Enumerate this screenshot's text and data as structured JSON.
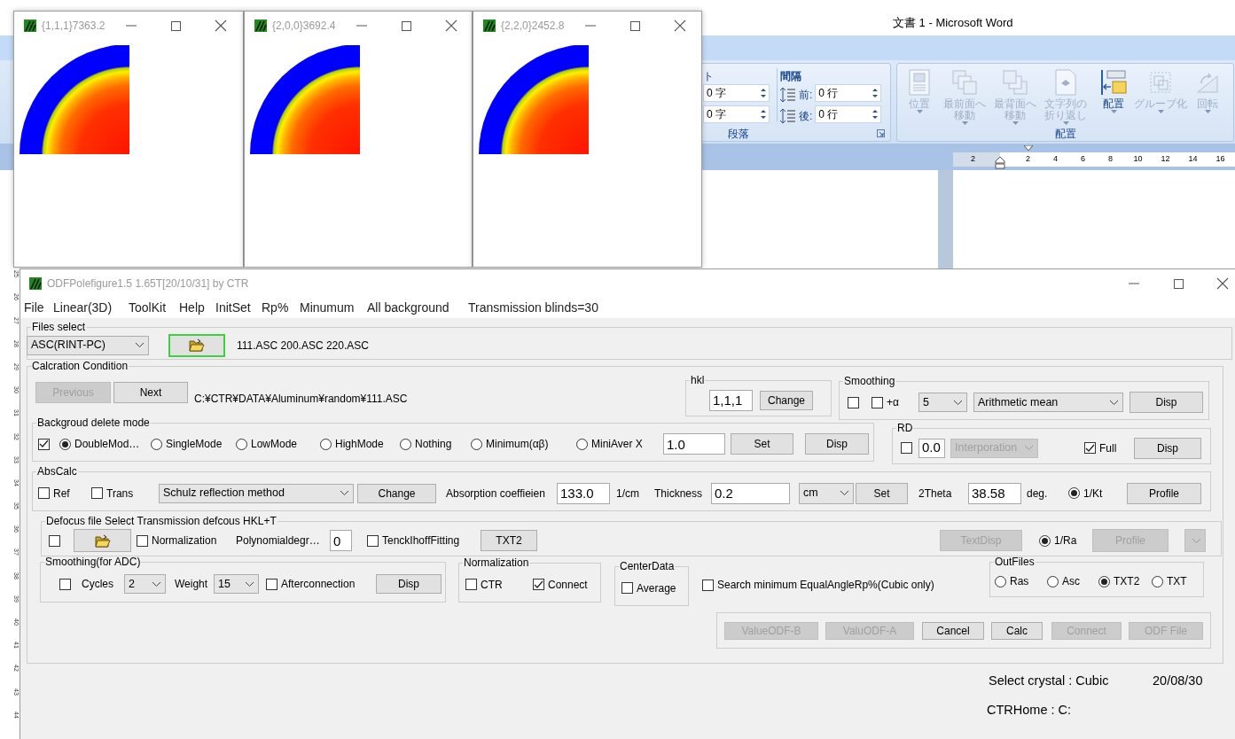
{
  "word": {
    "title": "文書 1 - Microsoft Word",
    "paragraph": {
      "cut_label": "ト",
      "indent_fields": [
        "0 字",
        "0 字"
      ],
      "spacing_label": "間隔",
      "spacing_fields": [
        {
          "label": "前:",
          "value": "0 行"
        },
        {
          "label": "後:",
          "value": "0 行"
        }
      ],
      "group_label": "段落"
    },
    "arrange": {
      "buttons": [
        {
          "label": "位置",
          "disabled": true
        },
        {
          "label": "最前面へ移動",
          "disabled": true
        },
        {
          "label": "最背面へ移動",
          "disabled": true
        },
        {
          "label": "文字列の折り返し",
          "disabled": true
        },
        {
          "label": "配置",
          "disabled": false
        },
        {
          "label": "グループ化",
          "disabled": true
        },
        {
          "label": "回転",
          "disabled": true
        }
      ],
      "group_label": "配置"
    },
    "ruler": [
      "2",
      "2",
      "4",
      "6",
      "8",
      "10",
      "12",
      "14",
      "16"
    ],
    "vertical_ruler": [
      "25",
      "26",
      "27",
      "28",
      "29",
      "30",
      "31",
      "32",
      "33",
      "34",
      "35",
      "36",
      "37",
      "38",
      "39",
      "40",
      "41",
      "42",
      "43",
      "44"
    ]
  },
  "pole_figures": [
    {
      "title": "{1,1,1}7363.2"
    },
    {
      "title": "{2,0,0}3692.4"
    },
    {
      "title": "{2,2,0}2452.8"
    }
  ],
  "app": {
    "title": "ODFPolefigure1.5 1.65T[20/10/31] by CTR",
    "menu": [
      "File",
      "Linear(3D)",
      "ToolKit",
      "Help",
      "InitSet",
      "Rp%",
      "Minumum",
      "All background",
      "Transmission blinds=30"
    ],
    "files": {
      "label": "Files select",
      "controls": [
        {
          "kind": "select",
          "value": "ASC(RINT-PC)",
          "disabled": false
        },
        {
          "kind": "folder-button",
          "focused": true,
          "disabled": false
        },
        {
          "kind": "text",
          "text": "111.ASC 200.ASC 220.ASC"
        }
      ]
    },
    "calc": {
      "label": "Calcration Condition",
      "rows": [
        {
          "items": [
            {
              "kind": "button",
              "label": "Previous",
              "disabled": true
            },
            {
              "kind": "button",
              "label": "Next",
              "disabled": false
            },
            {
              "kind": "text",
              "text": "C:¥CTR¥DATA¥Aluminum¥random¥111.ASC"
            },
            {
              "kind": "group",
              "label": "hkl",
              "controls": [
                {
                  "kind": "input",
                  "value": "1,1,1"
                },
                {
                  "kind": "button",
                  "label": "Change",
                  "disabled": false
                }
              ]
            },
            {
              "kind": "group",
              "label": "Smoothing",
              "controls": [
                {
                  "kind": "checkbox",
                  "checked": false
                },
                {
                  "kind": "checkbox",
                  "label": "+α",
                  "checked": false
                },
                {
                  "kind": "select",
                  "value": "5",
                  "disabled": false
                },
                {
                  "kind": "select",
                  "value": "Arithmetic mean",
                  "disabled": false
                },
                {
                  "kind": "button",
                  "label": "Disp",
                  "disabled": false
                }
              ]
            }
          ]
        },
        {
          "items": [
            {
              "kind": "group",
              "label": "Backgroud delete mode",
              "controls": [
                {
                  "kind": "checkbox",
                  "checked": true
                },
                {
                  "kind": "radio",
                  "label": "DoubleMod…",
                  "selected": true
                },
                {
                  "kind": "radio",
                  "label": "SingleMode",
                  "selected": false
                },
                {
                  "kind": "radio",
                  "label": "LowMode",
                  "selected": false
                },
                {
                  "kind": "radio",
                  "label": "HighMode",
                  "selected": false
                },
                {
                  "kind": "radio",
                  "label": "Nothing",
                  "selected": false
                },
                {
                  "kind": "radio",
                  "label": "Minimum(αβ)",
                  "selected": false
                },
                {
                  "kind": "radio",
                  "label": "MiniAver X",
                  "selected": false
                },
                {
                  "kind": "input",
                  "value": "1.0"
                },
                {
                  "kind": "button",
                  "label": "Set",
                  "disabled": false
                },
                {
                  "kind": "button",
                  "label": "Disp",
                  "disabled": false
                }
              ]
            },
            {
              "kind": "group",
              "label": "RD",
              "controls": [
                {
                  "kind": "checkbox",
                  "checked": false
                },
                {
                  "kind": "input",
                  "value": "0.0"
                },
                {
                  "kind": "select",
                  "value": "Interporation",
                  "disabled": true
                },
                {
                  "kind": "checkbox",
                  "label": "Full",
                  "checked": true
                },
                {
                  "kind": "button",
                  "label": "Disp",
                  "disabled": false
                }
              ]
            }
          ]
        },
        {
          "items": [
            {
              "kind": "group",
              "label": "AbsCalc",
              "controls": [
                {
                  "kind": "checkbox",
                  "label": "Ref",
                  "checked": false
                },
                {
                  "kind": "checkbox",
                  "label": "Trans",
                  "checked": false
                },
                {
                  "kind": "select",
                  "value": "Schulz reflection method",
                  "disabled": false
                },
                {
                  "kind": "button",
                  "label": "Change",
                  "disabled": false
                },
                {
                  "kind": "text",
                  "text": "Absorption coeffieien"
                },
                {
                  "kind": "input",
                  "value": "133.0"
                },
                {
                  "kind": "text",
                  "text": "1/cm"
                },
                {
                  "kind": "text",
                  "text": "Thickness"
                },
                {
                  "kind": "input",
                  "value": "0.2"
                },
                {
                  "kind": "select",
                  "value": "cm",
                  "disabled": false
                },
                {
                  "kind": "button",
                  "label": "Set",
                  "disabled": false
                },
                {
                  "kind": "text",
                  "text": "2Theta"
                },
                {
                  "kind": "input",
                  "value": "38.58"
                },
                {
                  "kind": "text",
                  "text": "deg."
                },
                {
                  "kind": "radio",
                  "label": "1/Kt",
                  "selected": true
                },
                {
                  "kind": "button",
                  "label": "Profile",
                  "disabled": false
                }
              ]
            }
          ]
        },
        {
          "items": [
            {
              "kind": "group",
              "label": "Defocus file Select Transmission defcous HKL+T",
              "controls": [
                {
                  "kind": "checkbox",
                  "checked": false
                },
                {
                  "kind": "folder-button",
                  "focused": false,
                  "disabled": false
                },
                {
                  "kind": "checkbox",
                  "label": "Normalization",
                  "checked": false
                },
                {
                  "kind": "text",
                  "text": "Polynomialdegr…"
                },
                {
                  "kind": "input",
                  "value": "0"
                },
                {
                  "kind": "checkbox",
                  "label": "TenckIhoffFitting",
                  "checked": false
                },
                {
                  "kind": "button",
                  "label": "TXT2",
                  "disabled": false
                },
                {
                  "kind": "button",
                  "label": "TextDisp",
                  "disabled": true
                },
                {
                  "kind": "radio",
                  "label": "1/Ra",
                  "selected": true
                },
                {
                  "kind": "button",
                  "label": "Profile",
                  "disabled": true
                },
                {
                  "kind": "select",
                  "disabled": true
                }
              ]
            }
          ]
        },
        {
          "items": [
            {
              "kind": "group",
              "label": "Smoothing(for ADC)",
              "controls": [
                {
                  "kind": "checkbox",
                  "checked": false
                },
                {
                  "kind": "text",
                  "text": "Cycles"
                },
                {
                  "kind": "select",
                  "value": "2",
                  "disabled": false
                },
                {
                  "kind": "text",
                  "text": "Weight"
                },
                {
                  "kind": "select",
                  "value": "15",
                  "disabled": false
                },
                {
                  "kind": "checkbox",
                  "label": "Afterconnection",
                  "checked": false
                },
                {
                  "kind": "button",
                  "label": "Disp",
                  "disabled": false
                }
              ]
            },
            {
              "kind": "group",
              "label": "Normalization",
              "controls": [
                {
                  "kind": "checkbox",
                  "label": "CTR",
                  "checked": false
                },
                {
                  "kind": "checkbox",
                  "label": "Connect",
                  "checked": true
                }
              ]
            },
            {
              "kind": "group",
              "label": "CenterData",
              "controls": [
                {
                  "kind": "checkbox",
                  "label": "Average",
                  "checked": false
                }
              ]
            },
            {
              "kind": "checkbox",
              "label": "Search minimum EqualAngleRp%(Cubic only)",
              "checked": false
            },
            {
              "kind": "group",
              "label": "OutFiles",
              "controls": [
                {
                  "kind": "radio",
                  "label": "Ras",
                  "selected": false
                },
                {
                  "kind": "radio",
                  "label": "Asc",
                  "selected": false
                },
                {
                  "kind": "radio",
                  "label": "TXT2",
                  "selected": true
                },
                {
                  "kind": "radio",
                  "label": "TXT",
                  "selected": false
                }
              ]
            }
          ]
        },
        {
          "items": [
            {
              "kind": "group",
              "controls": [
                {
                  "kind": "button",
                  "label": "ValueODF-B",
                  "disabled": true
                },
                {
                  "kind": "button",
                  "label": "ValuODF-A",
                  "disabled": true
                },
                {
                  "kind": "button",
                  "label": "Cancel",
                  "disabled": false
                },
                {
                  "kind": "button",
                  "label": "Calc",
                  "disabled": false
                },
                {
                  "kind": "button",
                  "label": "Connect",
                  "disabled": true
                },
                {
                  "kind": "button",
                  "label": "ODF File",
                  "disabled": true
                }
              ]
            }
          ]
        }
      ]
    },
    "status": {
      "crystal": "Select crystal : Cubic",
      "date": "20/08/30",
      "home": "CTRHome : C:"
    }
  }
}
